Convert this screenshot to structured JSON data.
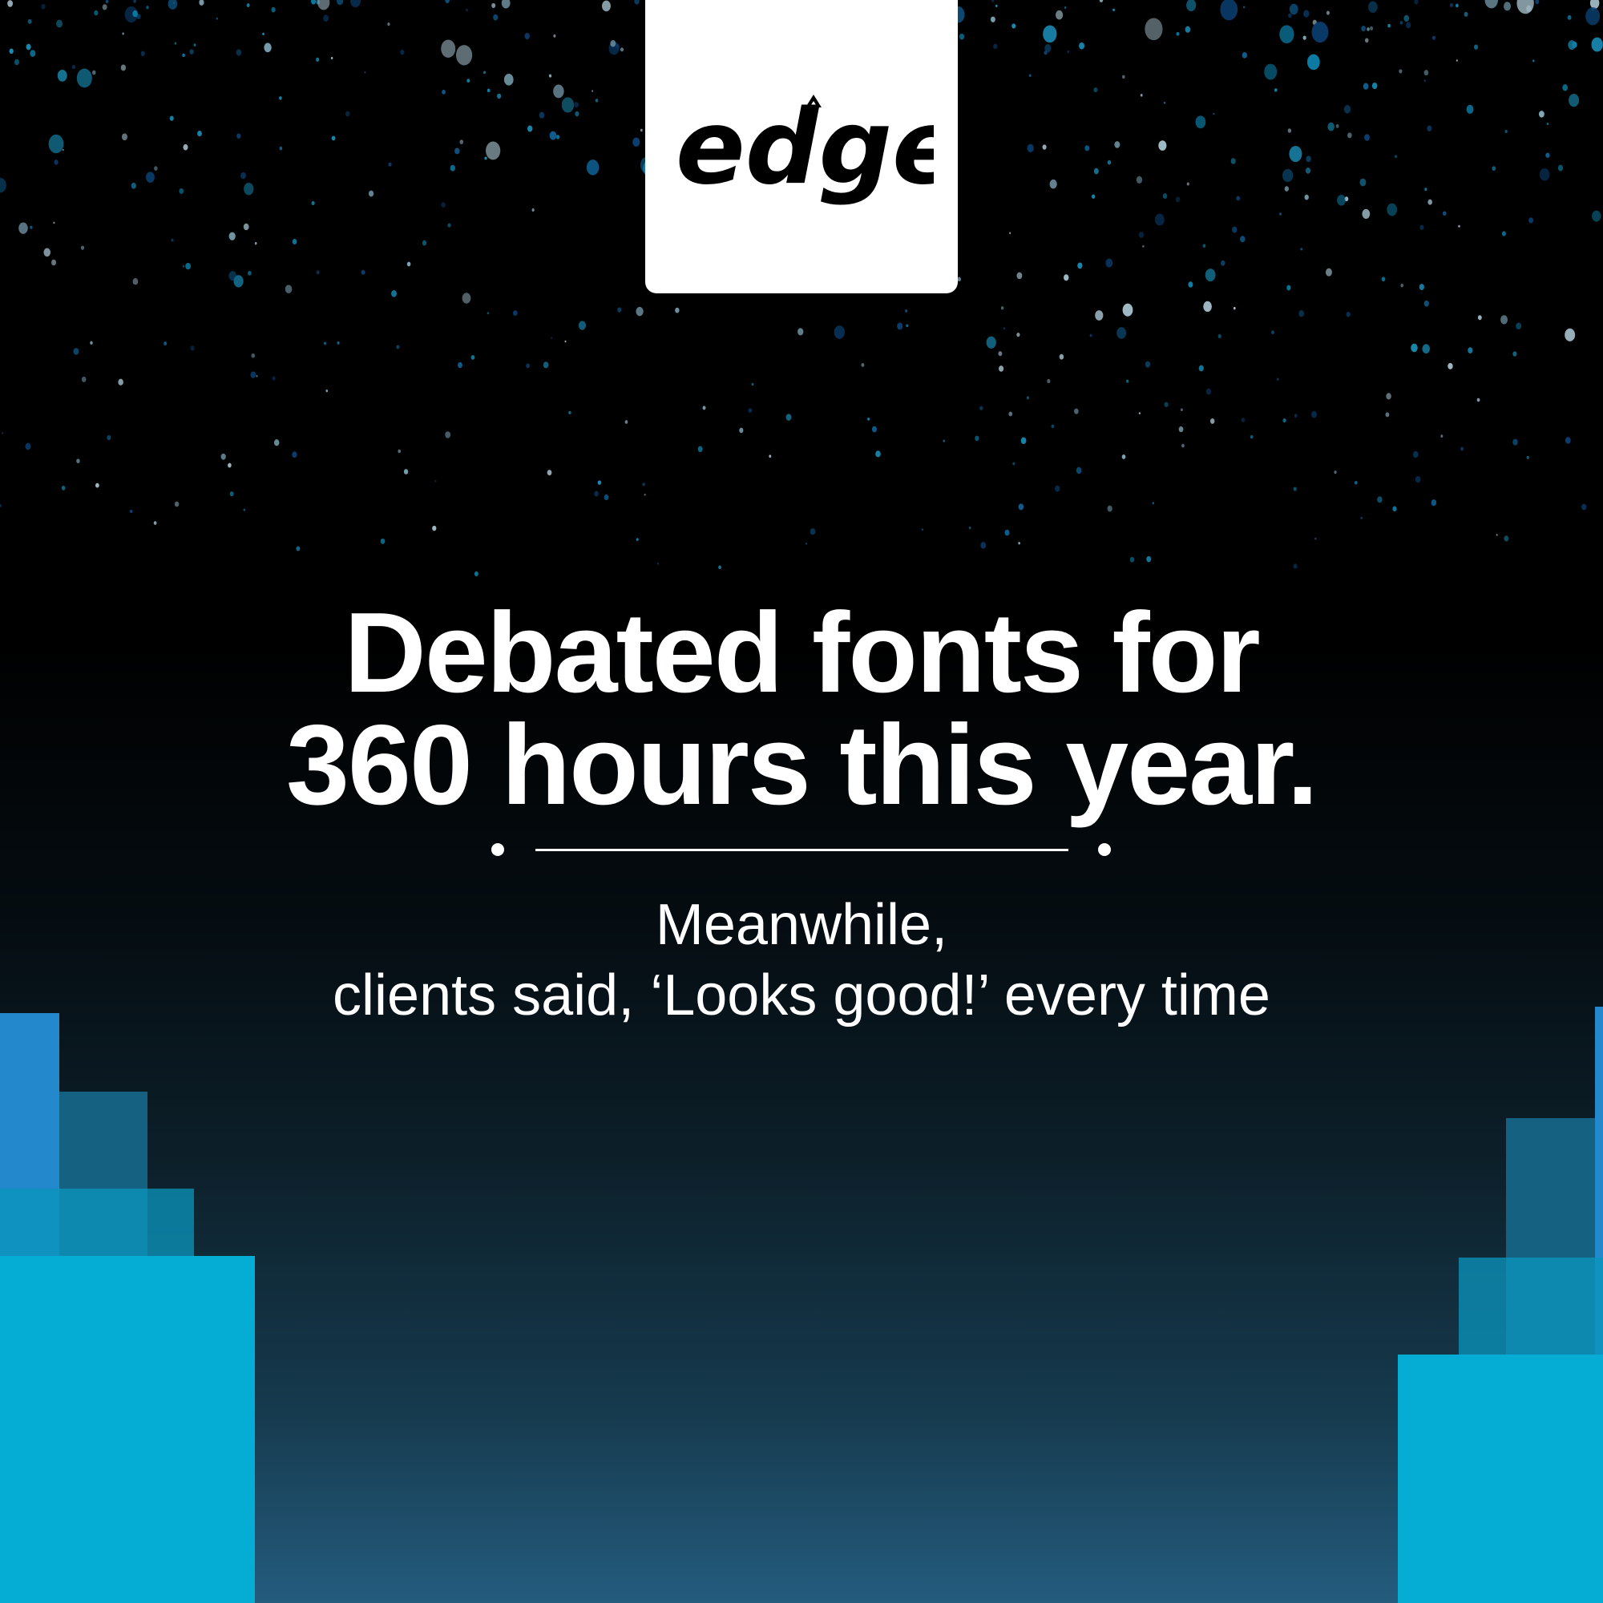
{
  "logo": {
    "text": "edge"
  },
  "headline": {
    "line1": "Debated fonts for",
    "line2": "360 hours this year."
  },
  "subtext": {
    "line1": "Meanwhile,",
    "line2": "clients said, ‘Looks good!’ every time"
  },
  "colors": {
    "background_top": "#000000",
    "background_bottom": "#245c7e",
    "accent_cyan": "#05acd4",
    "accent_blue": "#2389cc",
    "text": "#ffffff"
  }
}
